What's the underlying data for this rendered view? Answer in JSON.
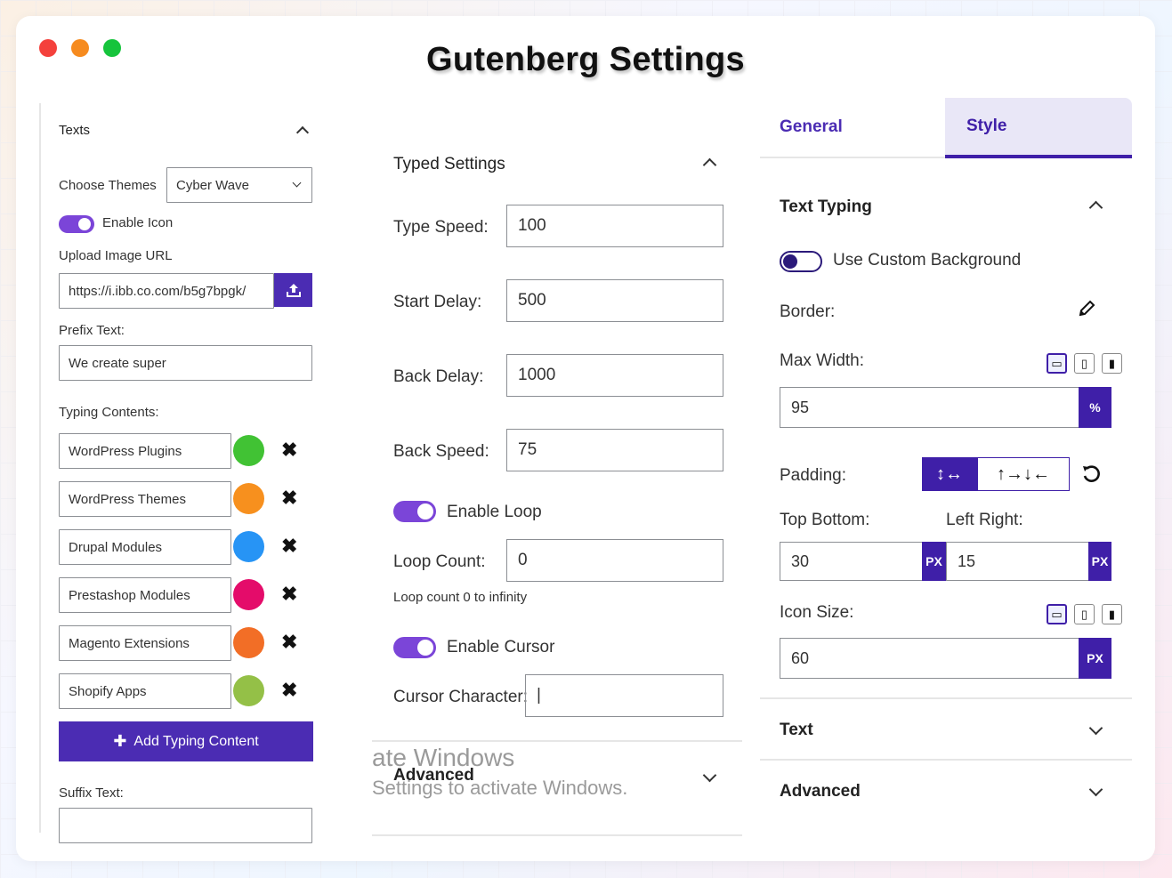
{
  "title": "Gutenberg Settings",
  "colors": {
    "accent": "#4b2cb3",
    "tab_active_bg": "#e9e7f7",
    "toggle_on": "#7b45d8"
  },
  "left": {
    "section": "Texts",
    "choose_themes_label": "Choose Themes",
    "theme_value": "Cyber Wave",
    "enable_icon": "Enable Icon",
    "upload_label": "Upload Image URL",
    "upload_value": "https://i.ibb.co.com/b5g7bpgk/",
    "prefix_label": "Prefix Text:",
    "prefix_value": "We create super",
    "typing_label": "Typing Contents:",
    "items": [
      {
        "text": "WordPress Plugins",
        "color": "#41c234"
      },
      {
        "text": "WordPress Themes",
        "color": "#f7901e"
      },
      {
        "text": "Drupal Modules",
        "color": "#2794f5"
      },
      {
        "text": "Prestashop Modules",
        "color": "#e40c6a"
      },
      {
        "text": "Magento Extensions",
        "color": "#f26e26"
      },
      {
        "text": "Shopify Apps",
        "color": "#94c047"
      }
    ],
    "remove_glyph": "✖",
    "add_label": "Add Typing Content",
    "add_glyph": "✚",
    "suffix_label": "Suffix Text:"
  },
  "middle": {
    "section": "Typed Settings",
    "type_speed_label": "Type Speed:",
    "type_speed": "100",
    "start_delay_label": "Start Delay:",
    "start_delay": "500",
    "back_delay_label": "Back Delay:",
    "back_delay": "1000",
    "back_speed_label": "Back Speed:",
    "back_speed": "75",
    "enable_loop": "Enable Loop",
    "loop_count_label": "Loop Count:",
    "loop_count": "0",
    "loop_hint": "Loop count 0 to infinity",
    "enable_cursor": "Enable Cursor",
    "cursor_char_label": "Cursor Character:",
    "cursor_char": "|",
    "advanced": "Advanced",
    "watermark_1": "ate Windows",
    "watermark_2": "Settings to activate Windows."
  },
  "right": {
    "tab_general": "General",
    "tab_style": "Style",
    "section": "Text Typing",
    "custom_bg": "Use Custom Background",
    "border_label": "Border:",
    "max_width_label": "Max Width:",
    "max_width": "95",
    "max_width_unit": "%",
    "padding_label": "Padding:",
    "padding_mode_1": "↕↔",
    "padding_mode_2": "↑→↓←",
    "top_bottom_label": "Top Bottom:",
    "left_right_label": "Left Right:",
    "top_bottom": "30",
    "left_right": "15",
    "unit_px": "PX",
    "icon_size_label": "Icon Size:",
    "icon_size": "60",
    "text_section": "Text",
    "advanced_section": "Advanced"
  }
}
